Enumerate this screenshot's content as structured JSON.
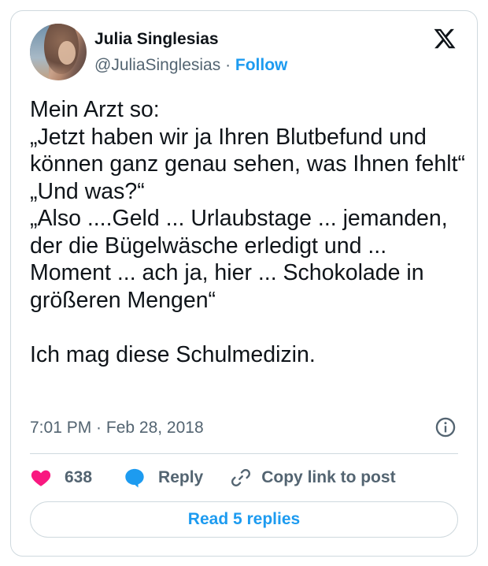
{
  "author": {
    "name": "Julia Singlesias",
    "handle": "@JuliaSinglesias",
    "separator": " · ",
    "follow_label": "Follow"
  },
  "tweet": {
    "text": "Mein Arzt so:\n„Jetzt haben wir ja Ihren Blutbefund und können ganz genau sehen, was Ihnen fehlt“\n„Und was?“\n„Also ....Geld ... Urlaubstage ... jemanden, der die Bügelwäsche erledigt und ... Moment ... ach ja, hier ... Schokolade in größeren Mengen“\n\nIch mag diese Schulmedizin.",
    "timestamp": "7:01 PM · Feb 28, 2018"
  },
  "actions": {
    "like_count": "638",
    "reply_label": "Reply",
    "copy_label": "Copy link to post"
  },
  "footer": {
    "read_replies_label": "Read 5 replies"
  },
  "icons": {
    "logo": "x-logo-icon",
    "info": "info-icon",
    "like": "heart-icon",
    "reply": "speech-bubble-icon",
    "copy": "link-icon"
  },
  "colors": {
    "accent": "#1d9bf0",
    "like": "#f91880",
    "text": "#0f1419",
    "muted": "#536471",
    "border": "#cfd9de"
  }
}
